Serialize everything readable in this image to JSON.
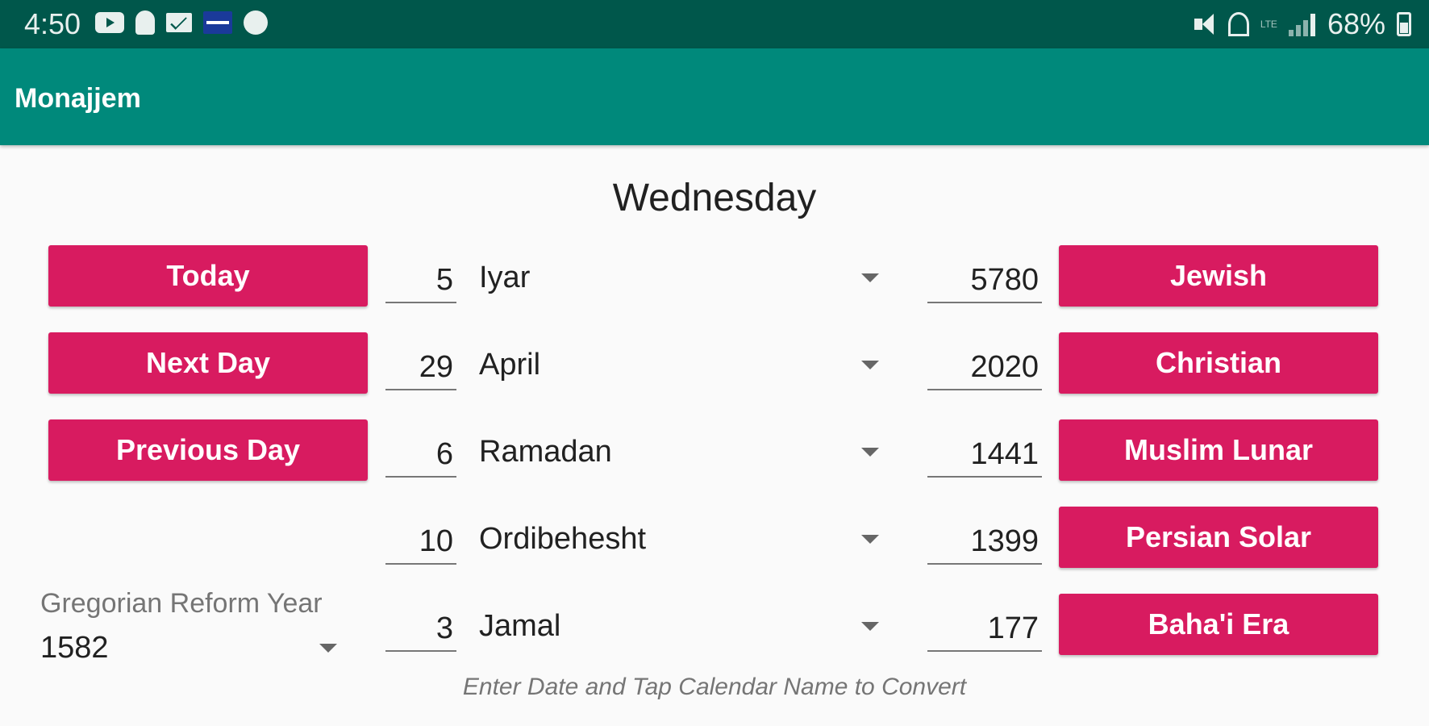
{
  "status_bar": {
    "time": "4:50",
    "battery": "68%",
    "left_icons": [
      "youtube-icon",
      "snapchat-icon",
      "mail-icon",
      "flag-icon",
      "chat-icon"
    ],
    "right_icons": [
      "mute-icon",
      "hotspot-icon",
      "lte-icon",
      "signal-icon",
      "battery-icon"
    ]
  },
  "app_bar": {
    "title": "Monajjem"
  },
  "day_name": "Wednesday",
  "nav_buttons": {
    "today": "Today",
    "next_day": "Next Day",
    "previous_day": "Previous Day"
  },
  "calendars": [
    {
      "day": "5",
      "month": "Iyar",
      "year": "5780",
      "button": "Jewish"
    },
    {
      "day": "29",
      "month": "April",
      "year": "2020",
      "button": "Christian"
    },
    {
      "day": "6",
      "month": "Ramadan",
      "year": "1441",
      "button": "Muslim Lunar"
    },
    {
      "day": "10",
      "month": "Ordibehesht",
      "year": "1399",
      "button": "Persian Solar"
    },
    {
      "day": "3",
      "month": "Jamal",
      "year": "177",
      "button": "Baha'i Era"
    }
  ],
  "reform": {
    "label": "Gregorian Reform Year",
    "value": "1582"
  },
  "hint": "Enter Date and Tap Calendar Name to Convert",
  "colors": {
    "status_bar": "#00574b",
    "app_bar": "#00897b",
    "accent": "#d81b60",
    "background": "#fafafa"
  }
}
